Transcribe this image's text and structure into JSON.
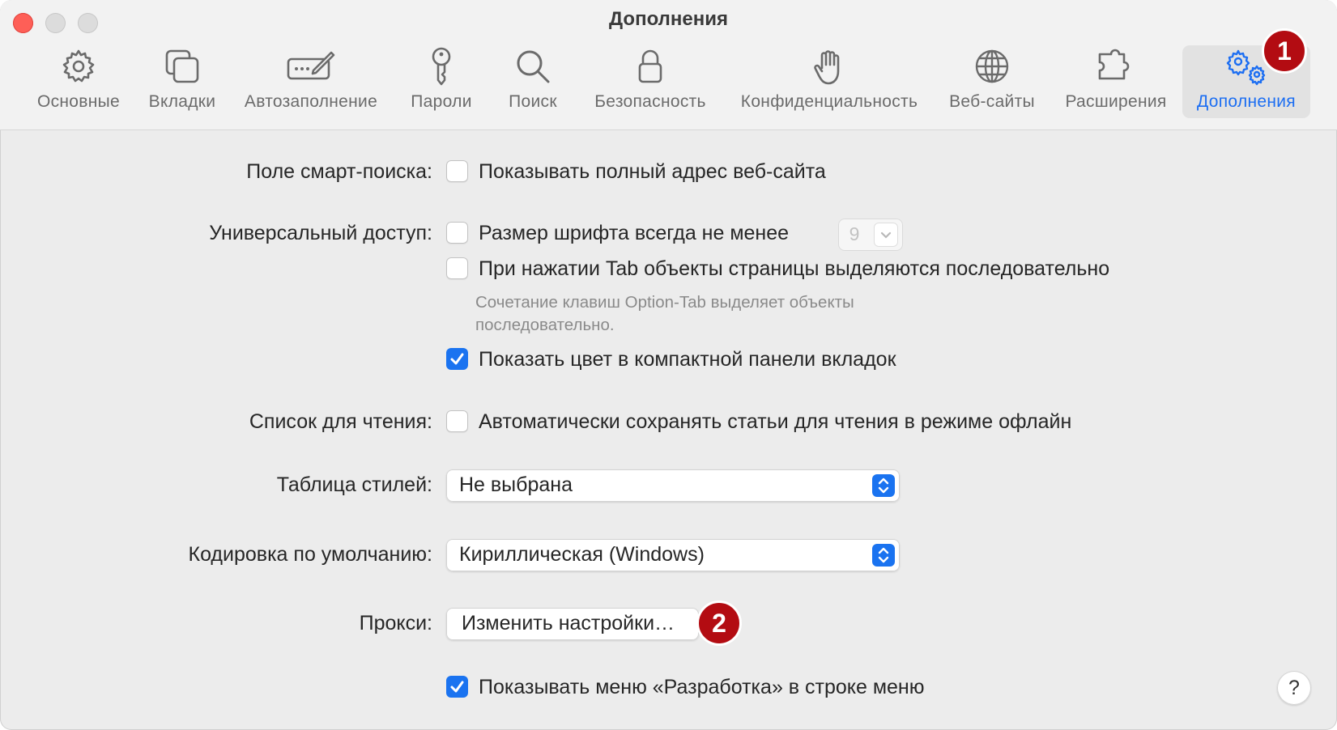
{
  "window": {
    "title": "Дополнения"
  },
  "toolbar": {
    "tabs": [
      {
        "id": "general",
        "label": "Основные",
        "icon": "gear-icon"
      },
      {
        "id": "tabs",
        "label": "Вкладки",
        "icon": "tabs-icon"
      },
      {
        "id": "autofill",
        "label": "Автозаполнение",
        "icon": "autofill-icon"
      },
      {
        "id": "passwords",
        "label": "Пароли",
        "icon": "key-icon"
      },
      {
        "id": "search",
        "label": "Поиск",
        "icon": "search-icon"
      },
      {
        "id": "security",
        "label": "Безопасность",
        "icon": "lock-icon"
      },
      {
        "id": "privacy",
        "label": "Конфиденциальность",
        "icon": "hand-icon"
      },
      {
        "id": "websites",
        "label": "Веб-сайты",
        "icon": "globe-icon"
      },
      {
        "id": "extensions",
        "label": "Расширения",
        "icon": "puzzle-icon"
      },
      {
        "id": "advanced",
        "label": "Дополнения",
        "icon": "gears-icon",
        "active": true
      }
    ],
    "accent_color": "#1c6ef2"
  },
  "annotations": {
    "badge1": "1",
    "badge2": "2",
    "badge_color": "#b30c12"
  },
  "settings": {
    "smart_search": {
      "label": "Поле смарт-поиска:",
      "option": "Показывать полный адрес веб-сайта",
      "checked": false
    },
    "accessibility": {
      "label": "Универсальный доступ:",
      "font_size_option": "Размер шрифта всегда не менее",
      "font_size_checked": false,
      "font_size_value": "9",
      "tab_option": "При нажатии Tab объекты страницы выделяются последовательно",
      "tab_checked": false,
      "hint": "Сочетание клавиш Option-Tab выделяет объекты последовательно.",
      "color_option": "Показать цвет в компактной панели вкладок",
      "color_checked": true
    },
    "reading_list": {
      "label": "Список для чтения:",
      "option": "Автоматически сохранять статьи для чтения в режиме офлайн",
      "checked": false
    },
    "style_sheet": {
      "label": "Таблица стилей:",
      "value": "Не выбрана"
    },
    "encoding": {
      "label": "Кодировка по умолчанию:",
      "value": "Кириллическая (Windows)"
    },
    "proxies": {
      "label": "Прокси:",
      "button": "Изменить настройки…"
    },
    "develop_menu": {
      "option": "Показывать меню «Разработка» в строке меню",
      "checked": true
    }
  },
  "help": {
    "label": "?"
  }
}
